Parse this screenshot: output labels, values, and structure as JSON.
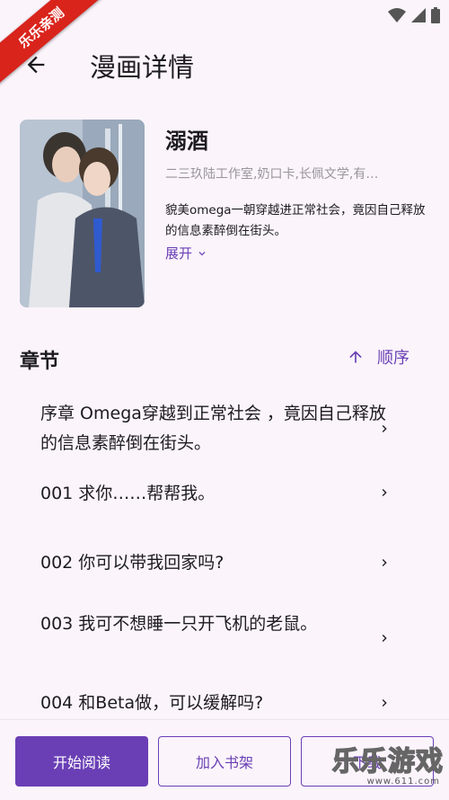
{
  "status_bar": {
    "icons": [
      "wifi-icon",
      "signal-icon",
      "battery-icon"
    ]
  },
  "ribbon": {
    "text": "乐乐亲测"
  },
  "app_bar": {
    "title": "漫画详情",
    "back_icon": "arrow-left-icon"
  },
  "comic": {
    "title": "溺酒",
    "authors": "二三玖陆工作室,奶口卡,长佩文学,有…",
    "summary": "貌美omega一朝穿越进正常社会，竟因自己释放的信息素醉倒在街头。",
    "expand_label": "展开"
  },
  "chapters": {
    "header": "章节",
    "sort_label": "顺序",
    "items": [
      {
        "label": "序章 Omega穿越到正常社会 ，竟因自己释放的信息素醉倒在街头。"
      },
      {
        "label": "001 求你……帮帮我。"
      },
      {
        "label": "002 你可以带我回家吗?"
      },
      {
        "label": "003 我可不想睡一只开飞机的老鼠。"
      },
      {
        "label": "004 和Beta做，可以缓解吗?"
      }
    ]
  },
  "bottom_bar": {
    "start_reading": "开始阅读",
    "add_shelf": "加入书架",
    "download": "下载"
  },
  "watermark": {
    "text": "乐乐游戏",
    "url": "www.611.com"
  },
  "colors": {
    "accent": "#6a3fb5",
    "background": "#fbf4fb",
    "ribbon": "#d9241c"
  }
}
